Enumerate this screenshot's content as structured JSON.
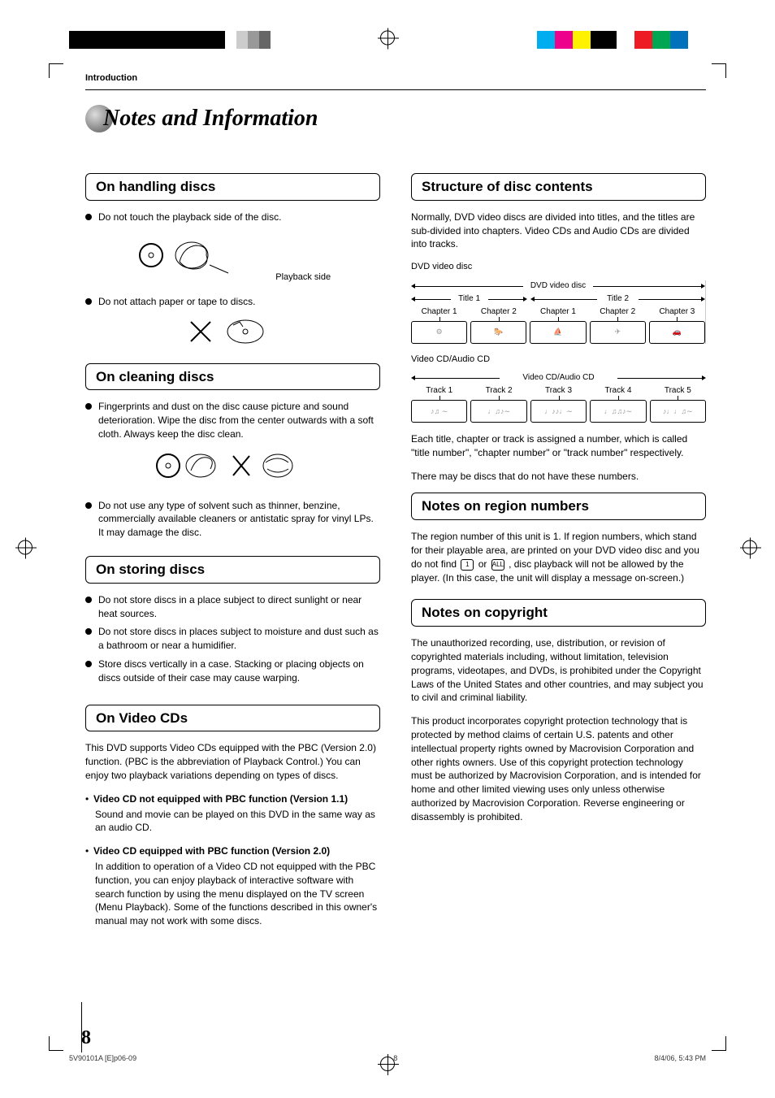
{
  "section_label": "Introduction",
  "page_title": "Notes and Information",
  "left": {
    "h1": "On handling discs",
    "b1": "Do not touch the playback side of the disc.",
    "ill1_label": "Playback side",
    "b2": "Do not attach paper or tape to discs.",
    "h2": "On cleaning discs",
    "b3": "Fingerprints and dust on the disc cause picture and sound deterioration. Wipe the disc from the center outwards with a soft cloth. Always keep the disc clean.",
    "b4": "Do not use any type of solvent such as thinner, benzine, commercially available cleaners or antistatic spray for vinyl LPs. It may damage the disc.",
    "h3": "On storing discs",
    "b5": "Do not store discs in a place subject to direct sunlight or near heat sources.",
    "b6": "Do not store discs in places subject to moisture and dust such as a bathroom or near a humidifier.",
    "b7": "Store discs vertically in a case. Stacking or placing objects on discs outside of their case may cause warping.",
    "h4": "On Video CDs",
    "p1": "This DVD supports Video CDs equipped with the PBC (Version 2.0) function. (PBC is the abbreviation of Playback Control.) You can enjoy two playback variations depending on types of discs.",
    "li1_t": "Video CD not equipped with PBC function (Version 1.1)",
    "li1_b": "Sound and movie can be played on this DVD in the same way as an audio CD.",
    "li2_t": "Video CD equipped with PBC function (Version 2.0)",
    "li2_b": "In addition to operation of a Video CD not equipped with the PBC function, you can enjoy playback of interactive software with search function by using the menu displayed on the TV screen (Menu Playback). Some of the functions described in this owner's manual may not work with some discs."
  },
  "right": {
    "h1": "Structure of disc contents",
    "p1": "Normally, DVD video discs are divided into titles, and the titles are sub-divided into chapters. Video CDs and Audio CDs are divided into tracks.",
    "d1_label": "DVD video disc",
    "d1_cap": "DVD video disc",
    "d1_t1": "Title 1",
    "d1_t2": "Title 2",
    "d1_c1": "Chapter 1",
    "d1_c2": "Chapter 2",
    "d1_c3": "Chapter 1",
    "d1_c4": "Chapter 2",
    "d1_c5": "Chapter 3",
    "d2_label": "Video CD/Audio CD",
    "d2_cap": "Video CD/Audio CD",
    "d2_t1": "Track 1",
    "d2_t2": "Track 2",
    "d2_t3": "Track 3",
    "d2_t4": "Track 4",
    "d2_t5": "Track 5",
    "p2": "Each title, chapter or track is assigned a number, which is called \"title number\", \"chapter number\" or \"track number\" respectively.",
    "p3": "There may be discs that do not have these numbers.",
    "h2": "Notes on region numbers",
    "p4a": "The region number of this unit is 1. If region numbers, which stand for their playable area, are printed on your DVD video disc and you do not find ",
    "p4b": " or ",
    "p4c": " , disc playback will not be allowed by the player. (In this case, the unit will display a message on-screen.)",
    "icon1": "1",
    "icon2": "ALL",
    "h3": "Notes on copyright",
    "p5": "The unauthorized recording, use, distribution, or revision of copyrighted materials including, without limitation, television programs, videotapes, and DVDs, is prohibited under the Copyright Laws of the United States and other countries, and may subject you to civil and criminal liability.",
    "p6": "This product incorporates copyright protection technology that is protected by method claims of certain U.S. patents and other intellectual property rights owned by Macrovision Corporation and other rights owners. Use of this copyright protection technology must be authorized by Macrovision Corporation, and is intended for home and other limited viewing uses only unless otherwise authorized by Macrovision Corporation. Reverse engineering or disassembly is prohibited."
  },
  "page_number": "8",
  "footer": {
    "l": "5V90101A [E]p06-09",
    "c": "8",
    "r": "8/4/06, 5:43 PM"
  },
  "reg_colors_left": [
    "#000",
    "#000",
    "#000",
    "#000",
    "#000",
    "#000",
    "#fff",
    "#ccc",
    "#999",
    "#666",
    "#fff"
  ],
  "reg_colors_right": [
    "#fff",
    "#00aeef",
    "#ec008c",
    "#fff200",
    "#000",
    "#fff",
    "#ed1c24",
    "#00a651",
    "#0072bc",
    "#fff"
  ]
}
